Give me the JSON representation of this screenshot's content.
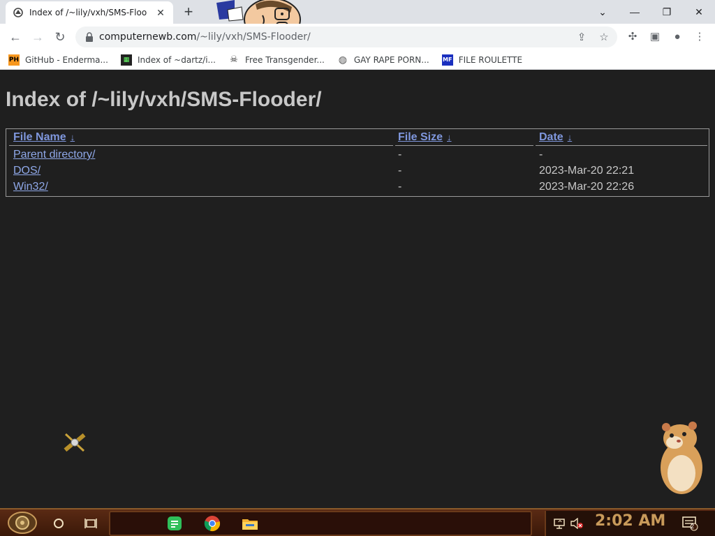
{
  "browser": {
    "tab_title": "Index of /~lily/vxh/SMS-Floo",
    "url_host": "computernewb.com",
    "url_path": "/~lily/vxh/SMS-Flooder/",
    "bookmarks": [
      {
        "label": "GitHub - Enderma...",
        "icon": "PH"
      },
      {
        "label": "Index of ~dartz/i...",
        "icon": "dartz"
      },
      {
        "label": "Free Transgender...",
        "icon": "globe-skull"
      },
      {
        "label": "GAY RAPE PORN...",
        "icon": "globe"
      },
      {
        "label": "FILE ROULETTE",
        "icon": "MF"
      }
    ]
  },
  "page": {
    "heading": "Index of /~lily/vxh/SMS-Flooder/",
    "columns": {
      "name": "File Name",
      "size": "File Size",
      "date": "Date",
      "sort_glyph": "↓"
    },
    "rows": [
      {
        "name": "Parent directory/",
        "size": "-",
        "date": "-"
      },
      {
        "name": "DOS/",
        "size": "-",
        "date": "2023-Mar-20 22:21"
      },
      {
        "name": "Win32/",
        "size": "-",
        "date": "2023-Mar-20 22:26"
      }
    ]
  },
  "taskbar": {
    "clock": "2:02 AM",
    "notification_count": "2"
  },
  "colors": {
    "page_bg": "#1f1f1f",
    "link": "#8fa8e8",
    "text": "#c8c8c8",
    "taskbar": "#4a2010"
  }
}
